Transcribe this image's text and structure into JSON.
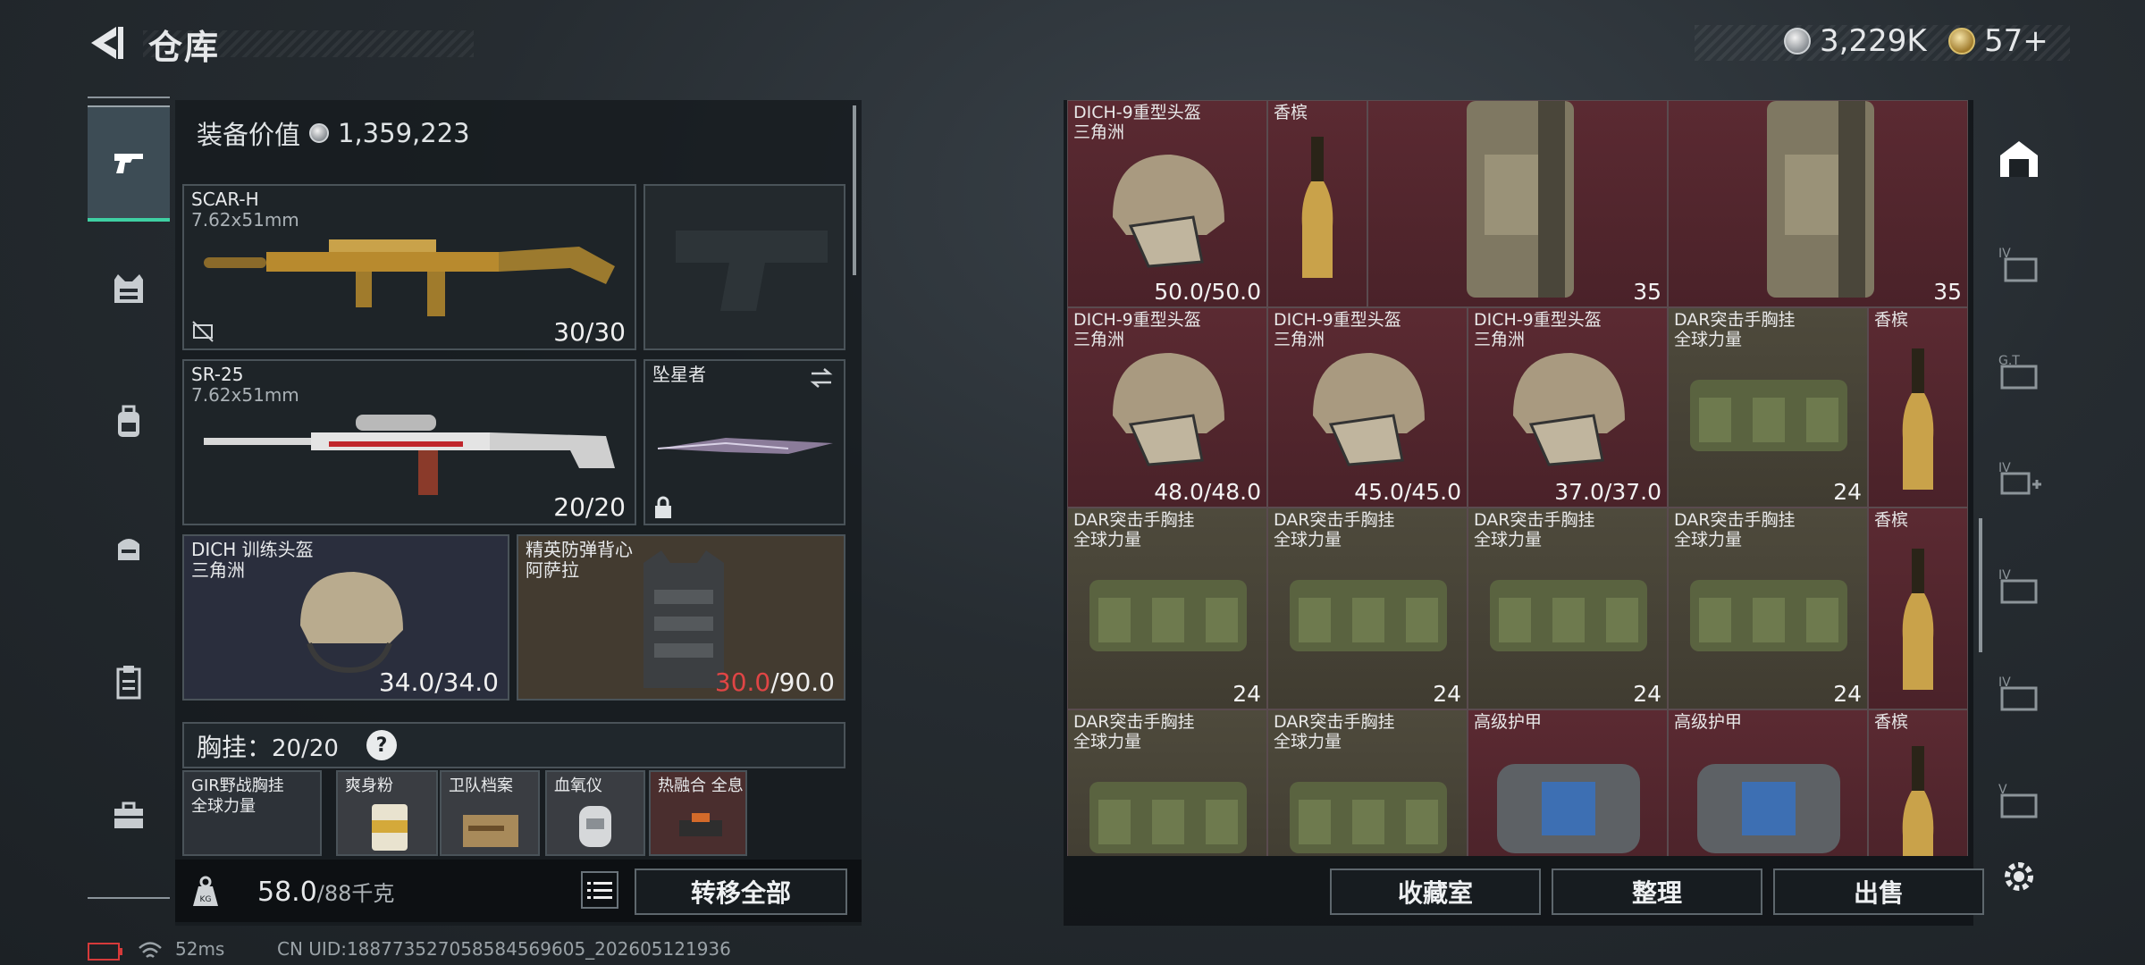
{
  "header": {
    "title": "仓库",
    "currency": [
      {
        "type": "silver",
        "value": "3,229K"
      },
      {
        "type": "gold",
        "value": "57+"
      }
    ]
  },
  "left_nav": [
    "pistol-icon",
    "vest-icon",
    "backpack-icon",
    "bag-icon",
    "clipboard-icon",
    "toolbox-icon"
  ],
  "equipment": {
    "value_label": "装备价值",
    "value": "1,359,223",
    "primary": {
      "name": "SCAR-H",
      "caliber": "7.62x51mm",
      "ammo": "30/30"
    },
    "secondary": {
      "name": "SR-25",
      "caliber": "7.62x51mm",
      "ammo": "20/20"
    },
    "melee": {
      "name": "坠星者"
    },
    "helmet": {
      "name": "DICH 训练头盔",
      "faction": "三角洲",
      "durability": "34.0/34.0"
    },
    "armor": {
      "name": "精英防弹背心",
      "faction": "阿萨拉",
      "durability_current": "30.0",
      "durability_max": "/90.0"
    },
    "chest_rig": {
      "label": "胸挂：",
      "capacity": "20/20",
      "help": "?"
    },
    "rig_items": [
      {
        "name": "GIR野战胸挂",
        "sub": "全球力量"
      },
      {
        "name": "爽身粉",
        "sub": ""
      },
      {
        "name": "卫队档案",
        "sub": ""
      },
      {
        "name": "血氧仪",
        "sub": ""
      },
      {
        "name": "热融合 全息",
        "sub": ""
      }
    ],
    "weight": {
      "current": "58.0",
      "max": "/88千克"
    },
    "transfer_all": "转移全部"
  },
  "storage": {
    "cells": [
      {
        "name": "DICH-9重型头盔",
        "sub": "三角洲",
        "qty": "50.0/50.0",
        "color": "red"
      },
      {
        "name": "香槟",
        "sub": "",
        "qty": "",
        "color": "red"
      },
      {
        "name": "",
        "sub": "",
        "qty": "35",
        "color": "red"
      },
      {
        "name": "",
        "sub": "",
        "qty": "35",
        "color": "red"
      },
      {
        "name": "DICH-9重型头盔",
        "sub": "三角洲",
        "qty": "48.0/48.0",
        "color": "red"
      },
      {
        "name": "DICH-9重型头盔",
        "sub": "三角洲",
        "qty": "45.0/45.0",
        "color": "red"
      },
      {
        "name": "DICH-9重型头盔",
        "sub": "三角洲",
        "qty": "37.0/37.0",
        "color": "red"
      },
      {
        "name": "DAR突击手胸挂",
        "sub": "全球力量",
        "qty": "24",
        "color": "tan"
      },
      {
        "name": "香槟",
        "sub": "",
        "qty": "",
        "color": "red"
      },
      {
        "name": "DAR突击手胸挂",
        "sub": "全球力量",
        "qty": "24",
        "color": "tan"
      },
      {
        "name": "DAR突击手胸挂",
        "sub": "全球力量",
        "qty": "24",
        "color": "tan"
      },
      {
        "name": "DAR突击手胸挂",
        "sub": "全球力量",
        "qty": "24",
        "color": "tan"
      },
      {
        "name": "DAR突击手胸挂",
        "sub": "全球力量",
        "qty": "24",
        "color": "tan"
      },
      {
        "name": "香槟",
        "sub": "",
        "qty": "",
        "color": "red"
      },
      {
        "name": "DAR突击手胸挂",
        "sub": "全球力量",
        "qty": "",
        "color": "tan"
      },
      {
        "name": "DAR突击手胸挂",
        "sub": "全球力量",
        "qty": "",
        "color": "tan"
      },
      {
        "name": "高级护甲",
        "sub": "",
        "qty": "",
        "color": "red"
      },
      {
        "name": "高级护甲",
        "sub": "",
        "qty": "",
        "color": "red"
      },
      {
        "name": "香槟",
        "sub": "",
        "qty": "",
        "color": "red"
      }
    ],
    "buttons": {
      "collection": "收藏室",
      "organize": "整理",
      "sell": "出售"
    }
  },
  "status_bar": {
    "ping": "52ms",
    "uid": "CN UID:188773527058584569605_202605121936"
  },
  "colors": {
    "accent": "#3fd0a3",
    "red_cell": "#5b2a32",
    "tan_cell": "#4e4a3c",
    "warning": "#e04545"
  }
}
